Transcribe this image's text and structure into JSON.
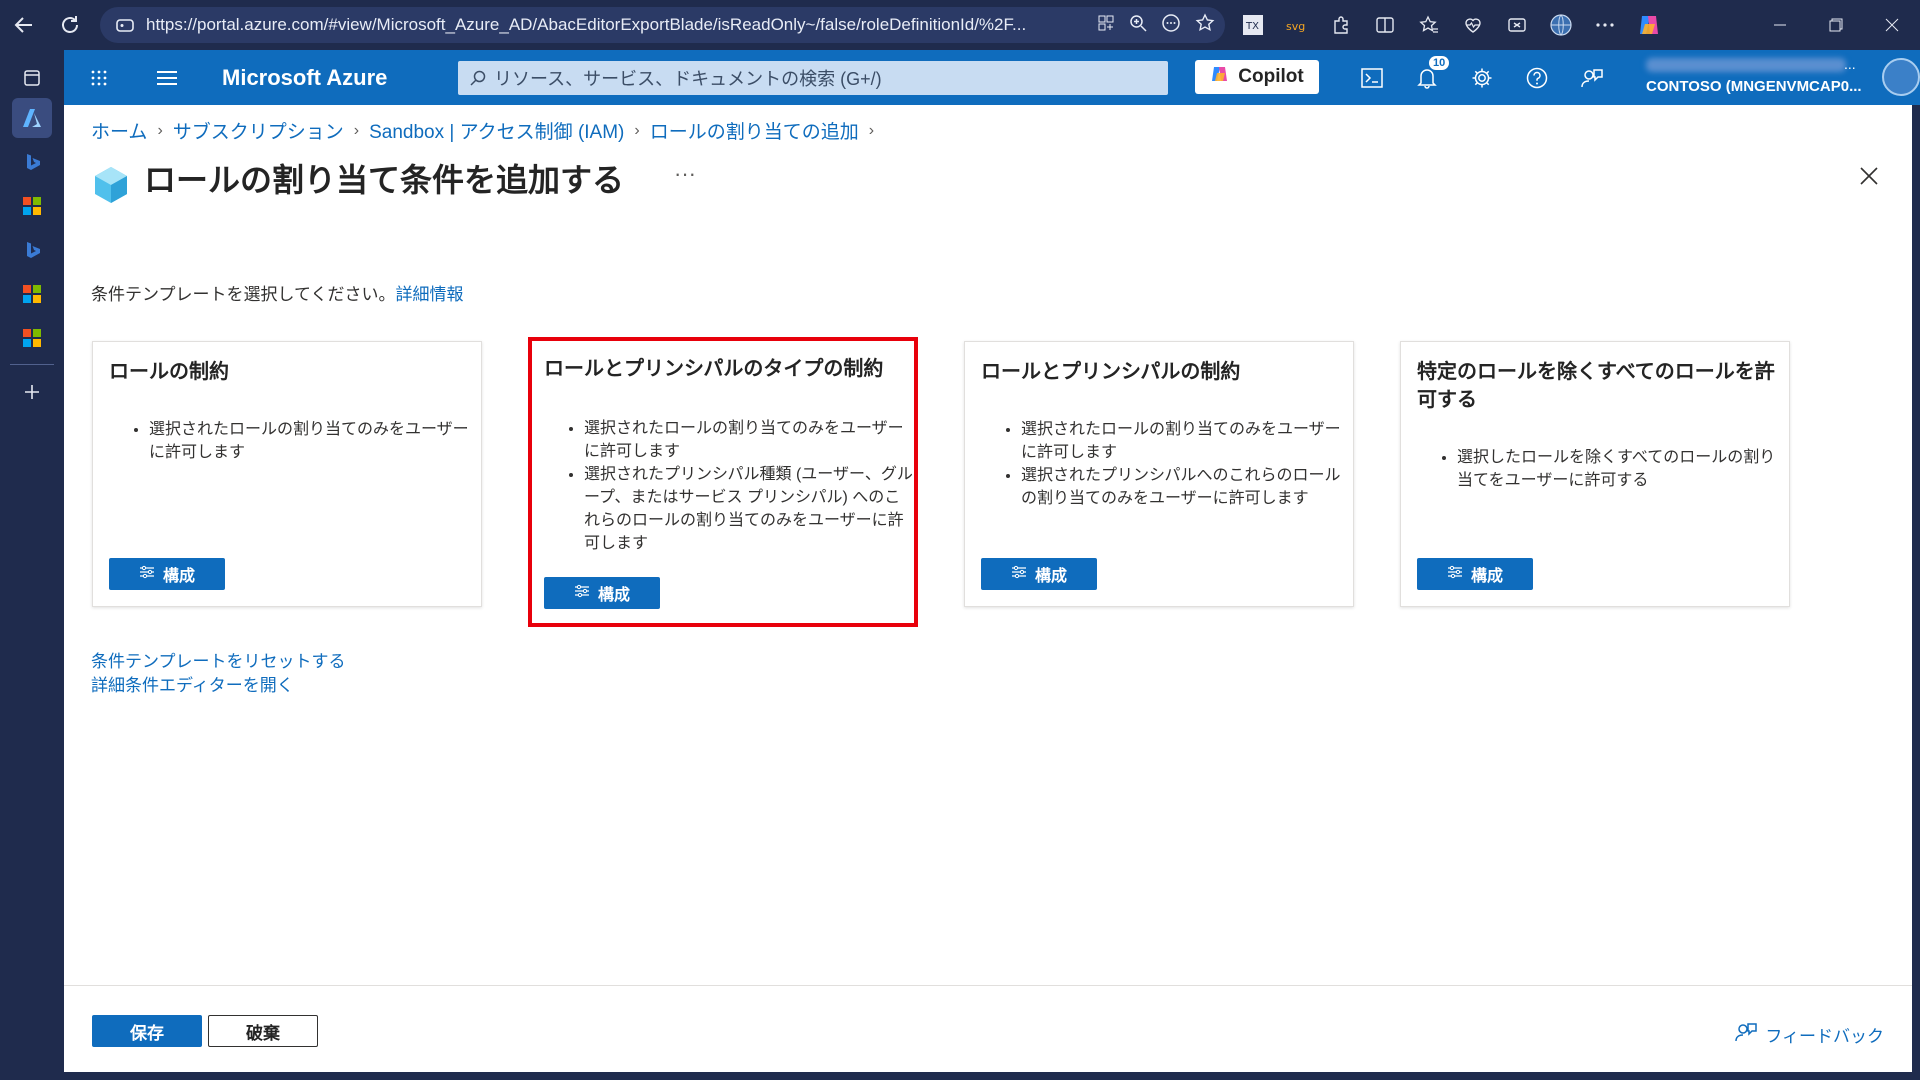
{
  "browser": {
    "url": "https://portal.azure.com/#view/Microsoft_Azure_AD/AbacEditorExportBlade/isReadOnly~/false/roleDefinitionId/%2F...",
    "extensions": [
      "tx-extension-icon",
      "svg-extension-icon",
      "extensions-puzzle-icon",
      "split-screen-icon",
      "favorites-icon",
      "browser-health-icon",
      "screenshot-icon",
      "profile-globe-icon",
      "more-icon",
      "copilot-edge-icon"
    ]
  },
  "header": {
    "brand": "Microsoft Azure",
    "search_placeholder": "リソース、サービス、ドキュメントの検索 (G+/)",
    "copilot_label": "Copilot",
    "notification_count": "10",
    "account_directory": "CONTOSO (MNGENVMCAP0...",
    "account_more": "..."
  },
  "breadcrumb": [
    "ホーム",
    "サブスクリプション",
    "Sandbox | アクセス制御 (IAM)",
    "ロールの割り当ての追加"
  ],
  "page": {
    "title": "ロールの割り当て条件を追加する",
    "more": "···",
    "instruction": "条件テンプレートを選択してください。",
    "learn_more": "詳細情報"
  },
  "cards": [
    {
      "title": "ロールの制約",
      "bullets": [
        "選択されたロールの割り当てのみをユーザーに許可します"
      ],
      "button": "構成"
    },
    {
      "title": "ロールとプリンシパルのタイプの制約",
      "bullets": [
        "選択されたロールの割り当てのみをユーザーに許可します",
        "選択されたプリンシパル種類 (ユーザー、グループ、またはサービス プリンシパル) へのこれらのロールの割り当てのみをユーザーに許可します"
      ],
      "button": "構成"
    },
    {
      "title": "ロールとプリンシパルの制約",
      "bullets": [
        "選択されたロールの割り当てのみをユーザーに許可します",
        "選択されたプリンシパルへのこれらのロールの割り当てのみをユーザーに許可します"
      ],
      "button": "構成"
    },
    {
      "title": "特定のロールを除くすべてのロールを許可する",
      "bullets": [
        "選択したロールを除くすべてのロールの割り当てをユーザーに許可する"
      ],
      "button": "構成"
    }
  ],
  "links": {
    "reset": "条件テンプレートをリセットする",
    "advanced": "詳細条件エディターを開く"
  },
  "footer": {
    "save": "保存",
    "discard": "破棄",
    "feedback": "フィードバック"
  },
  "colors": {
    "azure_blue": "#0f6cbd",
    "highlight_red": "#e8000b",
    "browser_dark": "#1f2b4d"
  }
}
